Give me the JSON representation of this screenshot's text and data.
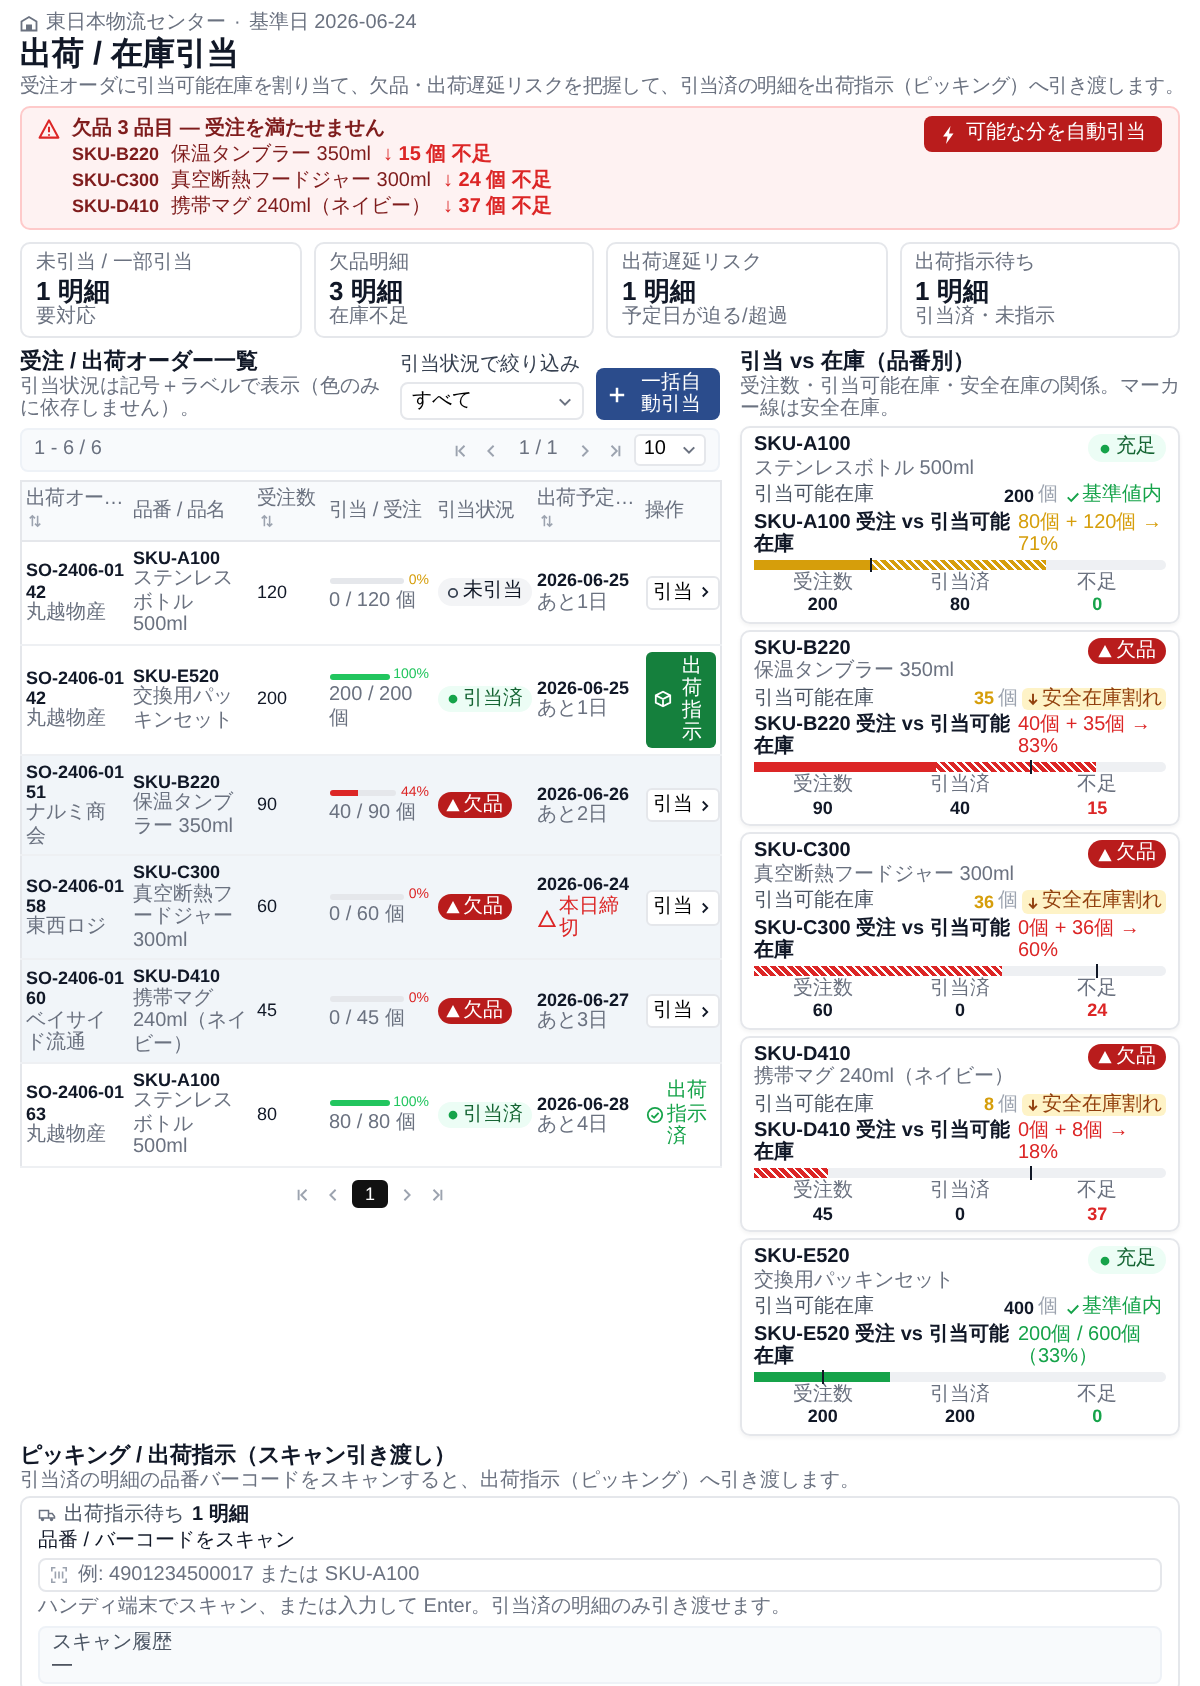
{
  "header": {
    "location": "東日本物流センター",
    "separator": "·",
    "base_date": "基準日 2026-06-24",
    "title": "出荷 / 在庫引当",
    "description": "受注オーダに引当可能在庫を割り当て、欠品・出荷遅延リスクを把握して、引当済の明細を出荷指示（ピッキング）へ引き渡します。"
  },
  "alert": {
    "title": "欠品 3 品目 — 受注を満たせません",
    "action": "可能な分を自動引当",
    "items": [
      {
        "sku": "SKU-B220",
        "name": "保温タンブラー 350ml",
        "shortage": "↓ 15 個 不足"
      },
      {
        "sku": "SKU-C300",
        "name": "真空断熱フードジャー 300ml",
        "shortage": "↓ 24 個 不足"
      },
      {
        "sku": "SKU-D410",
        "name": "携帯マグ 240ml（ネイビー）",
        "shortage": "↓ 37 個 不足"
      }
    ]
  },
  "stats": [
    {
      "label": "未引当 / 一部引当",
      "value": "1 明細",
      "note": "要対応"
    },
    {
      "label": "欠品明細",
      "value": "3 明細",
      "note": "在庫不足"
    },
    {
      "label": "出荷遅延リスク",
      "value": "1 明細",
      "note": "予定日が迫る/超過"
    },
    {
      "label": "出荷指示待ち",
      "value": "1 明細",
      "note": "引当済・未指示"
    }
  ],
  "orders": {
    "title": "受注 / 出荷オーダー一覧",
    "subtitle": "引当状況は記号＋ラベルで表示（色のみに依存しません）。",
    "filter": {
      "label": "引当状況で絞り込み",
      "value": "すべて"
    },
    "bulk_button": "一括自動引当",
    "range": "1 - 6 / 6",
    "page_status": "1 / 1",
    "page_size": "10",
    "columns": [
      {
        "label": "出荷オー…",
        "sortable": true
      },
      {
        "label": "品番 / 品名",
        "sortable": false
      },
      {
        "label": "受注数",
        "sortable": true
      },
      {
        "label": "引当 / 受注",
        "sortable": false
      },
      {
        "label": "引当状況",
        "sortable": false
      },
      {
        "label": "出荷予定…",
        "sortable": true
      },
      {
        "label": "操作",
        "sortable": false
      }
    ],
    "rows": [
      {
        "order_id": "SO-2406-0142",
        "customer": "丸越物産",
        "sku": "SKU-A100",
        "item": "ステンレスボトル 500ml",
        "quantity": "120",
        "level": 0,
        "percent": "0%",
        "allocation": "0 / 120 個",
        "status": {
          "kind": "unallocated",
          "label": "未引当"
        },
        "ship_date": "2026-06-25",
        "due": {
          "kind": "normal",
          "label": "あと1日"
        },
        "action": {
          "kind": "allocate",
          "label": "引当"
        }
      },
      {
        "order_id": "SO-2406-0142",
        "customer": "丸越物産",
        "sku": "SKU-E520",
        "item": "交換用パッキンセット",
        "quantity": "200",
        "level": 1,
        "percent": "100%",
        "allocation": "200 / 200 個",
        "status": {
          "kind": "allocated",
          "label": "引当済"
        },
        "ship_date": "2026-06-25",
        "due": {
          "kind": "normal",
          "label": "あと1日"
        },
        "action": {
          "kind": "ship",
          "label": "出荷指示"
        }
      },
      {
        "order_id": "SO-2406-0151",
        "customer": "ナルミ商会",
        "sku": "SKU-B220",
        "item": "保温タンブラー 350ml",
        "quantity": "90",
        "level": 0.44,
        "percent": "44%",
        "allocation": "40 / 90 個",
        "status": {
          "kind": "shortage",
          "label": "欠品"
        },
        "ship_date": "2026-06-26",
        "due": {
          "kind": "normal",
          "label": "あと2日"
        },
        "action": {
          "kind": "allocate",
          "label": "引当"
        }
      },
      {
        "order_id": "SO-2406-0158",
        "customer": "東西ロジ",
        "sku": "SKU-C300",
        "item": "真空断熱フードジャー 300ml",
        "quantity": "60",
        "level": 0,
        "percent": "0%",
        "allocation": "0 / 60 個",
        "status": {
          "kind": "shortage",
          "label": "欠品"
        },
        "ship_date": "2026-06-24",
        "due": {
          "kind": "urgent",
          "label": "本日締切"
        },
        "action": {
          "kind": "allocate",
          "label": "引当"
        }
      },
      {
        "order_id": "SO-2406-0160",
        "customer": "ベイサイド流通",
        "sku": "SKU-D410",
        "item": "携帯マグ 240ml（ネイビー）",
        "quantity": "45",
        "level": 0,
        "percent": "0%",
        "allocation": "0 / 45 個",
        "status": {
          "kind": "shortage",
          "label": "欠品"
        },
        "ship_date": "2026-06-27",
        "due": {
          "kind": "normal",
          "label": "あと3日"
        },
        "action": {
          "kind": "allocate",
          "label": "引当"
        }
      },
      {
        "order_id": "SO-2406-0163",
        "customer": "丸越物産",
        "sku": "SKU-A100",
        "item": "ステンレスボトル 500ml",
        "quantity": "80",
        "level": 1,
        "percent": "100%",
        "allocation": "80 / 80 個",
        "status": {
          "kind": "allocated",
          "label": "引当済"
        },
        "ship_date": "2026-06-28",
        "due": {
          "kind": "normal",
          "label": "あと4日"
        },
        "action": {
          "kind": "shipped",
          "label": "出荷指示済"
        }
      }
    ],
    "pages": [
      {
        "label": "1",
        "selected": true
      }
    ]
  },
  "stock": {
    "title": "引当 vs 在庫（品番別）",
    "subtitle": "受注数・引当可能在庫・安全在庫の関係。マーカー線は安全在庫。",
    "products": [
      {
        "sku": "SKU-A100",
        "name": "ステンレスボトル 500ml",
        "kind": "warn",
        "status": {
          "kind": "ok",
          "label": "充足"
        },
        "stock_label": "引当可能在庫",
        "stock": "200",
        "unit": "個",
        "stock_state": {
          "kind": "ok",
          "label": "基準値内"
        },
        "compare_label": "SKU-A100 受注 vs 引当可能在庫",
        "compare_value": "80個 + 120個 → 71%",
        "bar": {
          "level": 0.28,
          "reach": {
            "level": 0.71
          },
          "safety_marker": {
            "level": 0.28
          }
        },
        "figures": [
          {
            "label": "受注数",
            "value": "200",
            "kind": "plain"
          },
          {
            "label": "引当済",
            "value": "80",
            "kind": "plain"
          },
          {
            "label": "不足",
            "value": "0",
            "kind": "ok"
          }
        ]
      },
      {
        "sku": "SKU-B220",
        "name": "保温タンブラー 350ml",
        "kind": "danger",
        "status": {
          "kind": "shortage",
          "label": "欠品"
        },
        "stock_label": "引当可能在庫",
        "stock": "35",
        "unit": "個",
        "stock_state": {
          "kind": "low",
          "label": "安全在庫割れ"
        },
        "compare_label": "SKU-B220 受注 vs 引当可能在庫",
        "compare_value": "40個 + 35個 → 83%",
        "bar": {
          "level": 0.44,
          "reach": {
            "level": 0.83
          },
          "safety_marker": {
            "level": 0.67
          }
        },
        "figures": [
          {
            "label": "受注数",
            "value": "90",
            "kind": "plain"
          },
          {
            "label": "引当済",
            "value": "40",
            "kind": "plain"
          },
          {
            "label": "不足",
            "value": "15",
            "kind": "danger"
          }
        ]
      },
      {
        "sku": "SKU-C300",
        "name": "真空断熱フードジャー 300ml",
        "kind": "danger",
        "status": {
          "kind": "shortage",
          "label": "欠品"
        },
        "stock_label": "引当可能在庫",
        "stock": "36",
        "unit": "個",
        "stock_state": {
          "kind": "low",
          "label": "安全在庫割れ"
        },
        "compare_label": "SKU-C300 受注 vs 引当可能在庫",
        "compare_value": "0個 + 36個 → 60%",
        "bar": {
          "reach": {
            "level": 0.6
          },
          "safety_marker": {
            "level": 0.83
          }
        },
        "figures": [
          {
            "label": "受注数",
            "value": "60",
            "kind": "plain"
          },
          {
            "label": "引当済",
            "value": "0",
            "kind": "plain"
          },
          {
            "label": "不足",
            "value": "24",
            "kind": "danger"
          }
        ]
      },
      {
        "sku": "SKU-D410",
        "name": "携帯マグ 240ml（ネイビー）",
        "kind": "danger",
        "status": {
          "kind": "shortage",
          "label": "欠品"
        },
        "stock_label": "引当可能在庫",
        "stock": "8",
        "unit": "個",
        "stock_state": {
          "kind": "low",
          "label": "安全在庫割れ"
        },
        "compare_label": "SKU-D410 受注 vs 引当可能在庫",
        "compare_value": "0個 + 8個 → 18%",
        "bar": {
          "reach": {
            "level": 0.18
          },
          "safety_marker": {
            "level": 0.67
          }
        },
        "figures": [
          {
            "label": "受注数",
            "value": "45",
            "kind": "plain"
          },
          {
            "label": "引当済",
            "value": "0",
            "kind": "plain"
          },
          {
            "label": "不足",
            "value": "37",
            "kind": "danger"
          }
        ]
      },
      {
        "sku": "SKU-E520",
        "name": "交換用パッキンセット",
        "kind": "ok",
        "status": {
          "kind": "ok",
          "label": "充足"
        },
        "stock_label": "引当可能在庫",
        "stock": "400",
        "unit": "個",
        "stock_state": {
          "kind": "ok",
          "label": "基準値内"
        },
        "compare_label": "SKU-E520 受注 vs 引当可能在庫",
        "compare_value": "200個 / 600個（33%）",
        "bar": {
          "level": 0.33,
          "safety_marker": {
            "level": 0.165
          }
        },
        "figures": [
          {
            "label": "受注数",
            "value": "200",
            "kind": "plain"
          },
          {
            "label": "引当済",
            "value": "200",
            "kind": "plain"
          },
          {
            "label": "不足",
            "value": "0",
            "kind": "ok"
          }
        ]
      }
    ]
  },
  "picking": {
    "title": "ピッキング / 出荷指示（スキャン引き渡し）",
    "subtitle": "引当済の明細の品番バーコードをスキャンすると、出荷指示（ピッキング）へ引き渡します。",
    "pending_label": "出荷指示待ち",
    "pending_value": "1 明細",
    "scan_label": "品番 / バーコードをスキャン",
    "scan_placeholder": "例: 4901234500017 または SKU-A100",
    "hint": "ハンディ端末でスキャン、または入力して Enter。引当済の明細のみ引き渡せます。",
    "history": {
      "label": "スキャン履歴",
      "value": "—"
    }
  }
}
